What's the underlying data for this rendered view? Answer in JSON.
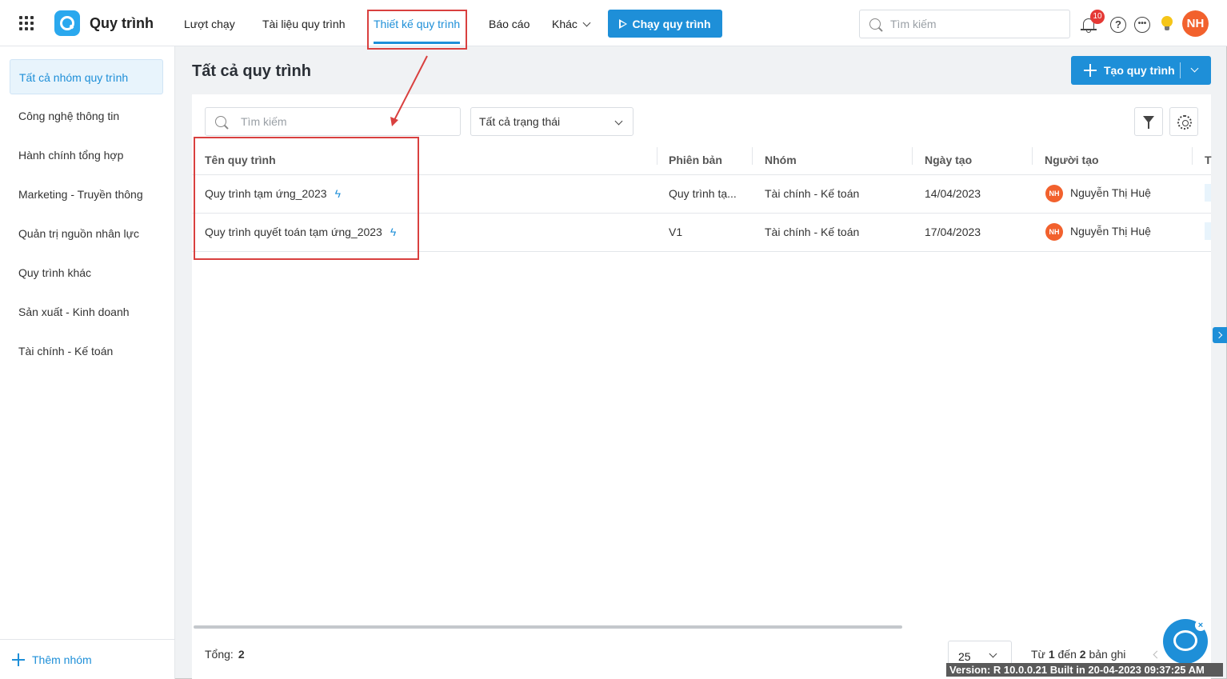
{
  "header": {
    "app_title": "Quy trình",
    "nav": [
      {
        "label": "Lượt chạy",
        "active": false
      },
      {
        "label": "Tài liệu quy trình",
        "active": false
      },
      {
        "label": "Thiết kế quy trình",
        "active": true
      },
      {
        "label": "Báo cáo",
        "active": false
      },
      {
        "label": "Khác",
        "active": false
      }
    ],
    "run_button": "Chạy quy trình",
    "search_placeholder": "Tìm kiếm",
    "notification_count": "10",
    "user_initials": "NH"
  },
  "sidebar": {
    "items": [
      {
        "label": "Tất cả nhóm quy trình",
        "active": true
      },
      {
        "label": "Công nghệ thông tin"
      },
      {
        "label": "Hành chính tổng hợp"
      },
      {
        "label": "Marketing - Truyền thông"
      },
      {
        "label": "Quản trị nguồn nhân lực"
      },
      {
        "label": "Quy trình khác"
      },
      {
        "label": "Sản xuất - Kinh doanh"
      },
      {
        "label": "Tài chính - Kế toán"
      }
    ],
    "add_group": "Thêm nhóm"
  },
  "main": {
    "title": "Tất cả quy trình",
    "create_button": "Tạo quy trình",
    "search_placeholder": "Tìm kiếm",
    "status_filter": "Tất cả trạng thái",
    "columns": [
      "Tên quy trình",
      "Phiên bản",
      "Nhóm",
      "Ngày tạo",
      "Người tạo",
      "T"
    ],
    "rows": [
      {
        "name": "Quy trình tạm ứng_2023",
        "version": "Quy trình tạ...",
        "group": "Tài chính - Kế toán",
        "created": "14/04/2023",
        "creator": "Nguyễn Thị Huệ",
        "creator_initials": "NH"
      },
      {
        "name": "Quy trình quyết toán tạm ứng_2023",
        "version": "V1",
        "group": "Tài chính - Kế toán",
        "created": "17/04/2023",
        "creator": "Nguyễn Thị Huệ",
        "creator_initials": "NH"
      }
    ],
    "footer": {
      "total_label": "Tổng:",
      "total": "2",
      "page_size": "25",
      "range_from_label": "Từ",
      "range_from": "1",
      "range_to_label": "đến",
      "range_to": "2",
      "range_suffix": "bản ghi"
    }
  },
  "version_text": "Version: R 10.0.0.21 Built in 20-04-2023 09:37:25 AM",
  "colors": {
    "accent": "#1e8fd8",
    "highlight": "#d9403f",
    "avatar": "#f2612d"
  }
}
